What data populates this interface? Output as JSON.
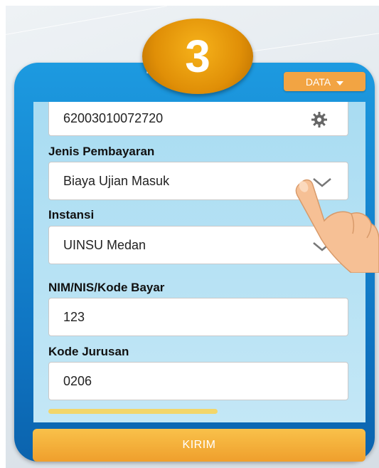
{
  "step_badge": "3",
  "header": {
    "title": "n"
  },
  "data_button": {
    "label": "DATA"
  },
  "form": {
    "top_field_value": "62003010072720",
    "jenis_pembayaran": {
      "label": "Jenis Pembayaran",
      "value": "Biaya Ujian Masuk"
    },
    "instansi": {
      "label": "Instansi",
      "value": "UINSU Medan"
    },
    "nim": {
      "label": "NIM/NIS/Kode Bayar",
      "value": "123"
    },
    "kode_jurusan": {
      "label": "Kode Jurusan",
      "value": "0206"
    }
  },
  "submit": {
    "label": "KIRIM"
  },
  "colors": {
    "badge": "#e08f07",
    "phone_blue": "#1d9ae0",
    "form_bg": "#b9e2f4",
    "accent_orange": "#f2a443",
    "progress_yellow": "#f3d66a"
  }
}
